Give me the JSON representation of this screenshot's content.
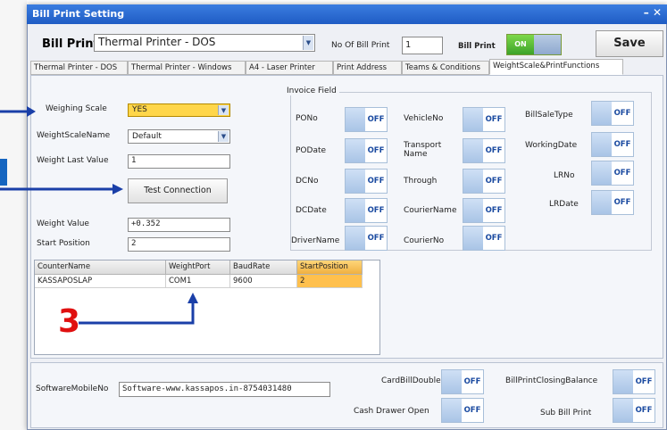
{
  "window": {
    "title": "Bill Print Setting",
    "close": "– ✕"
  },
  "header": {
    "bill_print_label": "Bill Print",
    "printer_selected": "Thermal Printer - DOS",
    "no_of_bill_print_label": "No Of Bill Print",
    "no_of_bill_print_value": "1",
    "bill_print_toggle_label": "Bill Print",
    "bill_print_toggle_state": "ON",
    "save_label": "Save"
  },
  "tabs": [
    "Thermal Printer - DOS",
    "Thermal Printer - Windows",
    "A4 - Laser Printer",
    "Print Address",
    "Teams & Conditions",
    "WeightScale&PrintFunctions"
  ],
  "left": {
    "weighing_scale_label": "Weighing Scale",
    "weighing_scale_value": "YES",
    "weight_scale_name_label": "WeightScaleName",
    "weight_scale_name_value": "Default",
    "weight_last_value_label": "Weight Last Value",
    "weight_last_value_value": "1",
    "test_connection_label": "Test Connection",
    "weight_value_label": "Weight Value",
    "weight_value_value": "+0.352",
    "start_position_label": "Start Position",
    "start_position_value": "2"
  },
  "invoice_field": {
    "title": "Invoice Field",
    "off": "OFF",
    "col1": [
      "PONo",
      "PODate",
      "DCNo",
      "DCDate",
      "DriverName"
    ],
    "col2": [
      "VehicleNo",
      "Transport Name",
      "Through",
      "CourierName",
      "CourierNo"
    ],
    "col3": [
      "BillSaleType",
      "WorkingDate",
      "LRNo",
      "LRDate"
    ]
  },
  "grid": {
    "headers": [
      "CounterName",
      "WeightPort",
      "BaudRate",
      "StartPosition"
    ],
    "row": [
      "KASSAPOSLAP",
      "COM1",
      "9600",
      "2"
    ]
  },
  "annotation": {
    "number": "3"
  },
  "bottom": {
    "software_mobile_label": "SoftwareMobileNo",
    "software_mobile_value": "Software-www.kassapos.in-8754031480",
    "card_bill_double": "CardBillDouble",
    "cash_drawer_open": "Cash Drawer Open",
    "bill_print_closing_balance": "BillPrintClosingBalance",
    "sub_bill_print": "Sub Bill Print",
    "off": "OFF"
  },
  "colors": {
    "accent": "#1f5cc4",
    "annotation_blue": "#1a3fa8",
    "annotation_red": "#e01010",
    "on_green": "#3da32a",
    "highlight": "#ffc04d"
  }
}
